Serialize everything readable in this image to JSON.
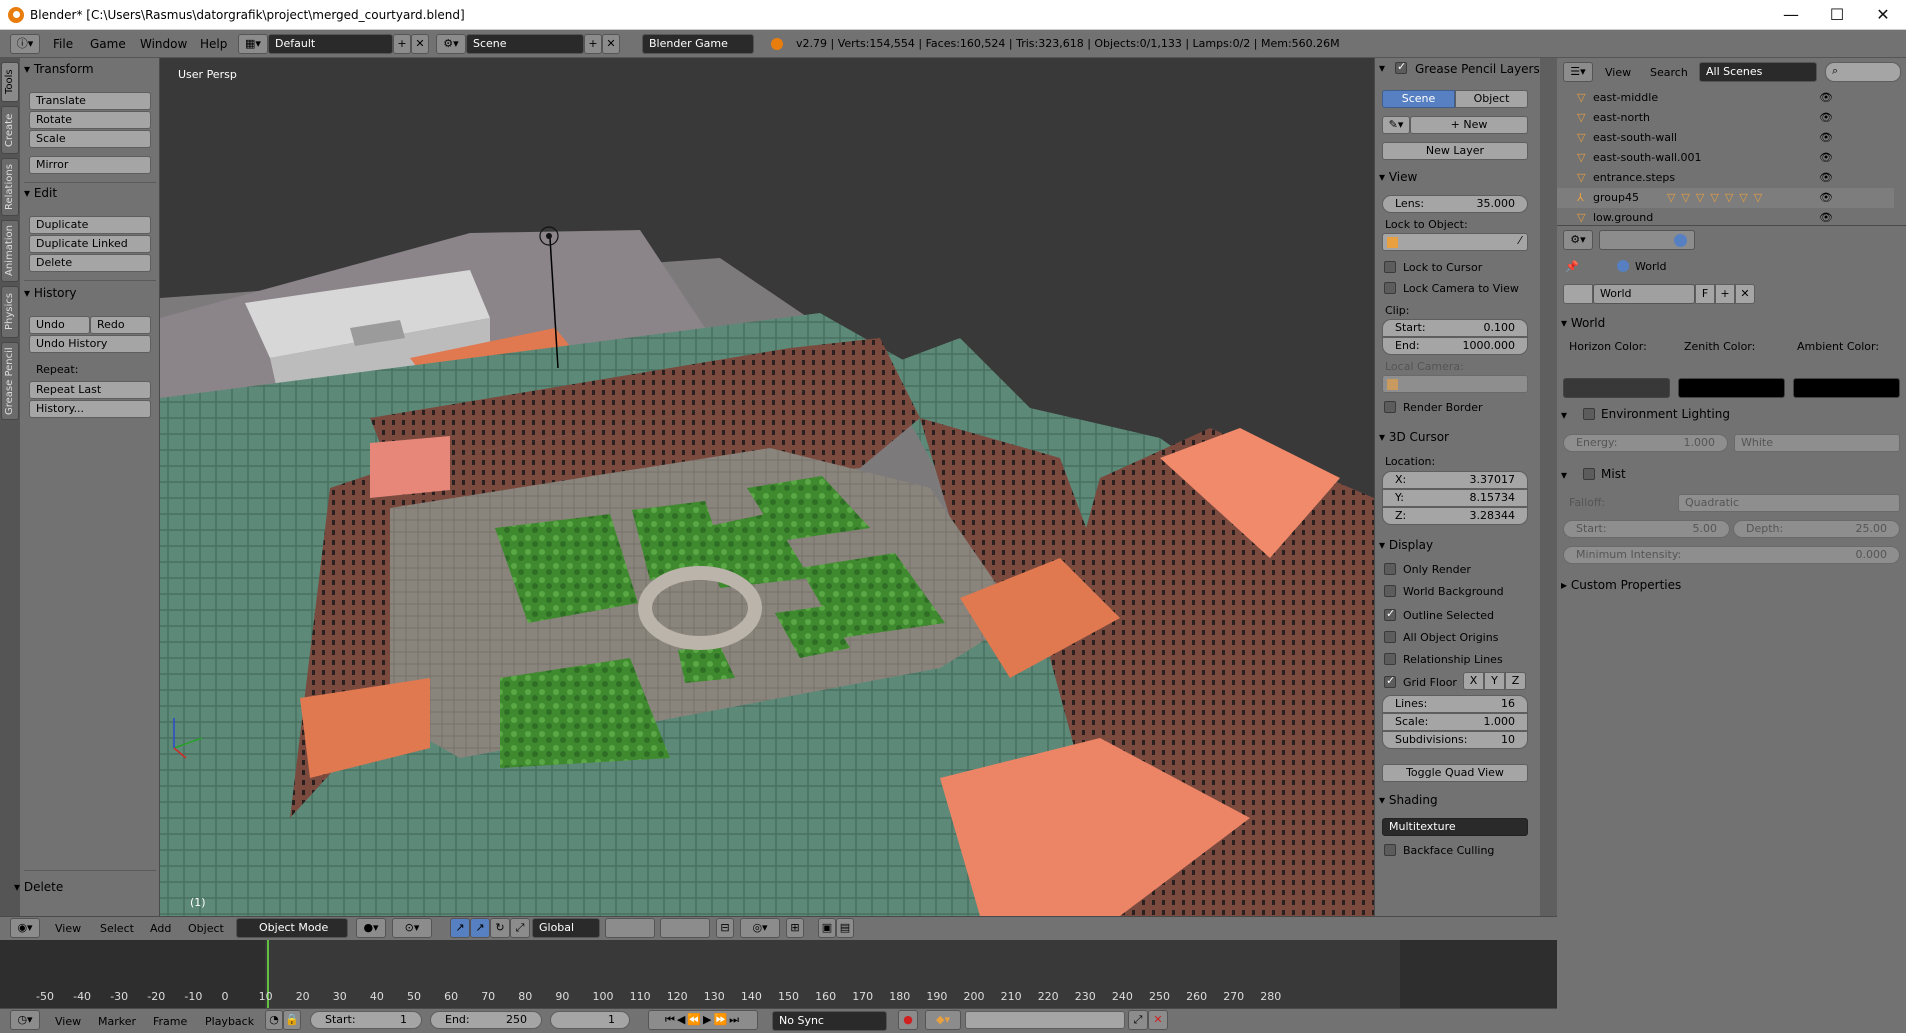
{
  "window": {
    "title": "Blender* [C:\\Users\\Rasmus\\datorgrafik\\project\\merged_courtyard.blend]",
    "min_glyph": "—",
    "max_glyph": "☐",
    "close_glyph": "✕"
  },
  "infobar": {
    "menus": [
      "File",
      "Game",
      "Window",
      "Help"
    ],
    "layout": "Default",
    "scene": "Scene",
    "engine": "Blender Game",
    "stats": "v2.79 | Verts:154,554 | Faces:160,524 | Tris:323,618 | Objects:0/1,133 | Lamps:0/2 | Mem:560.26M"
  },
  "tabs": [
    "Tools",
    "Create",
    "Relations",
    "Animation",
    "Physics",
    "Grease Pencil"
  ],
  "toolshelf": {
    "transform": {
      "title": "Transform",
      "items": [
        "Translate",
        "Rotate",
        "Scale",
        "Mirror"
      ]
    },
    "edit": {
      "title": "Edit",
      "items": [
        "Duplicate",
        "Duplicate Linked",
        "Delete"
      ]
    },
    "history": {
      "title": "History",
      "undo": "Undo",
      "redo": "Redo",
      "undo_history": "Undo History",
      "repeat_label": "Repeat:",
      "repeat_last": "Repeat Last",
      "history_btn": "History..."
    },
    "operator": "Delete"
  },
  "viewport": {
    "label": "User Persp",
    "frame_label": "(1)"
  },
  "npanel": {
    "grease": {
      "title": "Grease Pencil Layers",
      "scene": "Scene",
      "object": "Object",
      "new": "New",
      "new_layer": "New Layer"
    },
    "view": {
      "title": "View",
      "lens_label": "Lens:",
      "lens": "35.000",
      "lock_obj": "Lock to Object:",
      "lock_cursor": "Lock to Cursor",
      "lock_camera": "Lock Camera to View",
      "clip": "Clip:",
      "start_label": "Start:",
      "start": "0.100",
      "end_label": "End:",
      "end": "1000.000",
      "local_camera": "Local Camera:",
      "render_border": "Render Border"
    },
    "cursor": {
      "title": "3D Cursor",
      "location": "Location:",
      "x_label": "X:",
      "x": "3.37017",
      "y_label": "Y:",
      "y": "8.15734",
      "z_label": "Z:",
      "z": "3.28344"
    },
    "display": {
      "title": "Display",
      "only_render": "Only Render",
      "world_bg": "World Background",
      "outline": "Outline Selected",
      "origins": "All Object Origins",
      "rel_lines": "Relationship Lines",
      "grid_floor": "Grid Floor",
      "x": "X",
      "y": "Y",
      "z": "Z",
      "lines_label": "Lines:",
      "lines": "16",
      "scale_label": "Scale:",
      "scale": "1.000",
      "subdiv_label": "Subdivisions:",
      "subdiv": "10",
      "quad": "Toggle Quad View"
    },
    "shading": {
      "title": "Shading",
      "mode": "Multitexture",
      "backface": "Backface Culling"
    }
  },
  "outliner": {
    "menus": [
      "View",
      "Search"
    ],
    "scope": "All Scenes",
    "rows": [
      "east-middle",
      "east-north",
      "east-south-wall",
      "east-south-wall.001",
      "entrance.steps",
      "group45",
      "low.ground"
    ]
  },
  "props": {
    "breadcrumb": "World",
    "world_field": "World",
    "f_btn": "F",
    "world_title": "World",
    "horizon": "Horizon Color:",
    "zenith": "Zenith Color:",
    "ambient": "Ambient Color:",
    "env_title": "Environment Lighting",
    "energy_label": "Energy:",
    "energy": "1.000",
    "env_color": "White",
    "mist_title": "Mist",
    "falloff_label": "Falloff:",
    "falloff": "Quadratic",
    "mist_start_label": "Start:",
    "mist_start": "5.00",
    "depth_label": "Depth:",
    "depth": "25.00",
    "min_int_label": "Minimum Intensity:",
    "min_int": "0.000",
    "custom": "Custom Properties"
  },
  "viewheader": {
    "menus": [
      "View",
      "Select",
      "Add",
      "Object"
    ],
    "mode": "Object Mode",
    "orientation": "Global"
  },
  "timeline": {
    "ticks": [
      "-50",
      "-40",
      "-30",
      "-20",
      "-10",
      "0",
      "10",
      "20",
      "30",
      "40",
      "50",
      "60",
      "70",
      "80",
      "90",
      "100",
      "110",
      "120",
      "130",
      "140",
      "150",
      "160",
      "170",
      "180",
      "190",
      "200",
      "210",
      "220",
      "230",
      "240",
      "250",
      "260",
      "270",
      "280"
    ],
    "menus": [
      "View",
      "Marker",
      "Frame",
      "Playback"
    ],
    "start_label": "Start:",
    "start": "1",
    "end_label": "End:",
    "end": "250",
    "current": "1",
    "sync": "No Sync"
  },
  "colors": {
    "accent": "#5680c2",
    "bg": "#727272",
    "viewport": "#393939",
    "frame_line": "#60c040"
  }
}
